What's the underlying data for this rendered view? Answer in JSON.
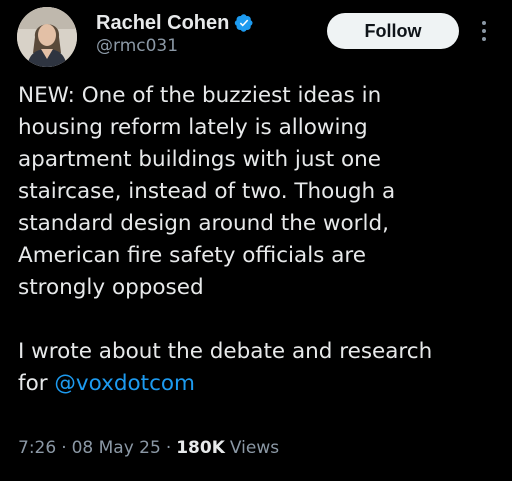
{
  "author": {
    "display_name": "Rachel Cohen",
    "handle": "@rmc031",
    "verified": true,
    "avatar_icon": "profile-photo"
  },
  "actions": {
    "follow_label": "Follow",
    "more_icon": "more-vertical-icon"
  },
  "tweet": {
    "lines": [
      "NEW: One of the buzziest ideas in",
      "housing reform lately is allowing",
      "apartment buildings with just one",
      "staircase, instead of two. Though a",
      "standard design around the world,",
      "American fire safety officials are",
      "strongly opposed"
    ],
    "paragraph2_line1": "I wrote about the debate and research",
    "paragraph2_prefix": "for",
    "mention": "@voxdotcom"
  },
  "meta": {
    "time": "7:26",
    "date": "08 May 25",
    "separator": "·",
    "views_count": "180K",
    "views_label": "Views"
  },
  "colors": {
    "background": "#000000",
    "text": "#e7e9ea",
    "secondary": "#8b98a5",
    "accent": "#1d9bf0",
    "follow_bg": "#eff3f4"
  }
}
